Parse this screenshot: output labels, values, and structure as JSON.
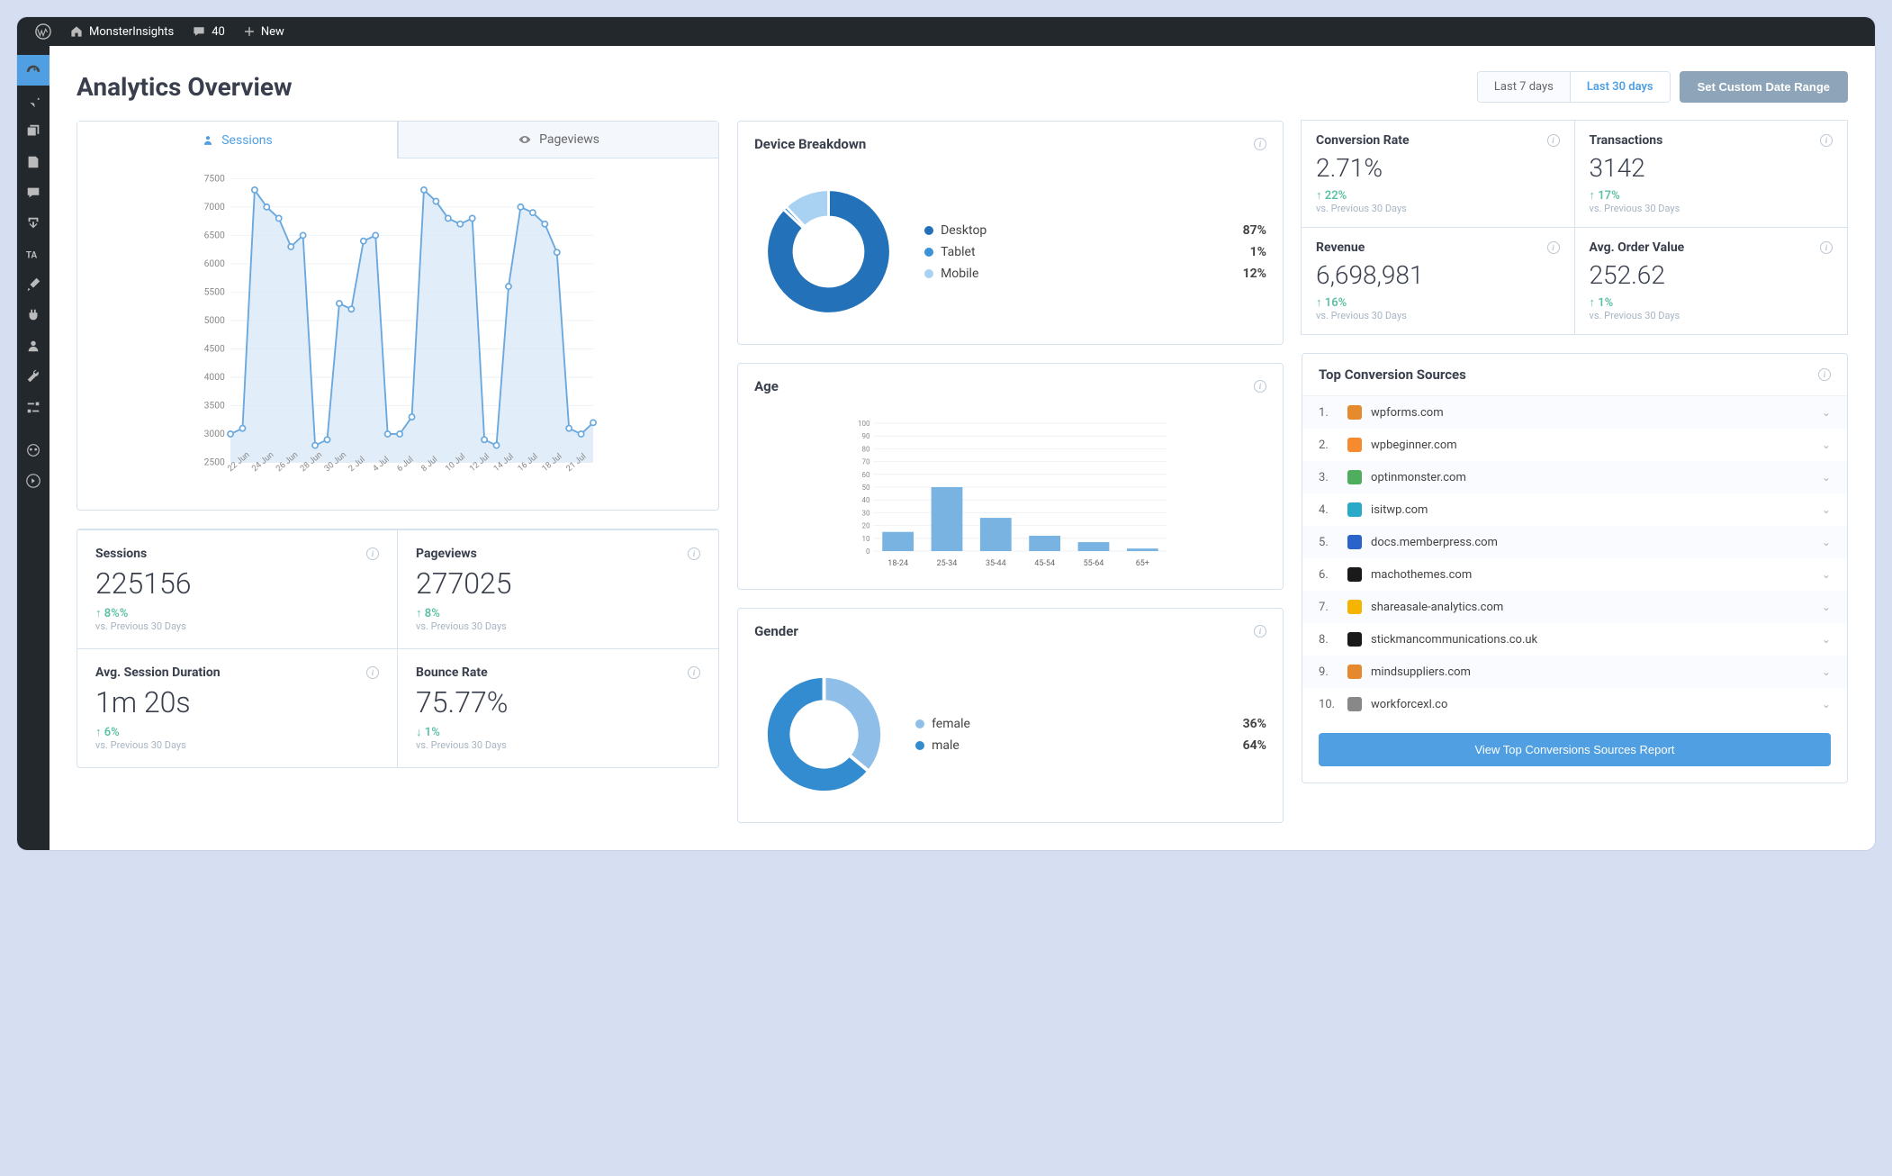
{
  "adminbar": {
    "site": "MonsterInsights",
    "comments": "40",
    "new": "New"
  },
  "page_title": "Analytics Overview",
  "date_range": {
    "tab7": "Last 7 days",
    "tab30": "Last 30 days",
    "custom": "Set Custom Date Range"
  },
  "main_chart": {
    "tab_sessions": "Sessions",
    "tab_pageviews": "Pageviews"
  },
  "stats": [
    {
      "label": "Sessions",
      "value": "225156",
      "delta": "↑ 8%%",
      "dir": "up",
      "vs": "vs. Previous 30 Days"
    },
    {
      "label": "Pageviews",
      "value": "277025",
      "delta": "↑ 8%",
      "dir": "up",
      "vs": "vs. Previous 30 Days"
    },
    {
      "label": "Avg. Session Duration",
      "value": "1m 20s",
      "delta": "↑ 6%",
      "dir": "up",
      "vs": "vs. Previous 30 Days"
    },
    {
      "label": "Bounce Rate",
      "value": "75.77%",
      "delta": "↓ 1%",
      "dir": "down",
      "vs": "vs. Previous 30 Days"
    }
  ],
  "device": {
    "title": "Device Breakdown",
    "legend": [
      {
        "label": "Desktop",
        "value": "87%",
        "color": "#2372b9"
      },
      {
        "label": "Tablet",
        "value": "1%",
        "color": "#3a92d8"
      },
      {
        "label": "Mobile",
        "value": "12%",
        "color": "#a9d2f2"
      }
    ]
  },
  "age": {
    "title": "Age"
  },
  "gender": {
    "title": "Gender",
    "legend": [
      {
        "label": "female",
        "value": "36%",
        "color": "#8fbfe8"
      },
      {
        "label": "male",
        "value": "64%",
        "color": "#338bd0"
      }
    ]
  },
  "ecom": [
    {
      "label": "Conversion Rate",
      "value": "2.71%",
      "delta": "↑ 22%",
      "vs": "vs. Previous 30 Days"
    },
    {
      "label": "Transactions",
      "value": "3142",
      "delta": "↑ 17%",
      "vs": "vs. Previous 30 Days"
    },
    {
      "label": "Revenue",
      "value": "6,698,981",
      "delta": "↑ 16%",
      "vs": "vs. Previous 30 Days"
    },
    {
      "label": "Avg. Order Value",
      "value": "252.62",
      "delta": "↑ 1%",
      "vs": "vs. Previous 30 Days"
    }
  ],
  "sources": {
    "title": "Top Conversion Sources",
    "items": [
      {
        "n": "1.",
        "name": "wpforms.com",
        "color": "#e68a2e"
      },
      {
        "n": "2.",
        "name": "wpbeginner.com",
        "color": "#f58a2e"
      },
      {
        "n": "3.",
        "name": "optinmonster.com",
        "color": "#4fae5e"
      },
      {
        "n": "4.",
        "name": "isitwp.com",
        "color": "#2aa9c9"
      },
      {
        "n": "5.",
        "name": "docs.memberpress.com",
        "color": "#2a63c9"
      },
      {
        "n": "6.",
        "name": "machothemes.com",
        "color": "#1a1a1a"
      },
      {
        "n": "7.",
        "name": "shareasale-analytics.com",
        "color": "#f4b400"
      },
      {
        "n": "8.",
        "name": "stickmancommunications.co.uk",
        "color": "#1a1a1a"
      },
      {
        "n": "9.",
        "name": "mindsuppliers.com",
        "color": "#e6882e"
      },
      {
        "n": "10.",
        "name": "workforcexl.co",
        "color": "#888888"
      }
    ],
    "button": "View Top Conversions Sources Report"
  },
  "chart_data": [
    {
      "type": "line",
      "id": "sessions-line",
      "title": "Sessions",
      "ylabel": "Sessions",
      "ylim": [
        2500,
        7500
      ],
      "yticks": [
        2500,
        3000,
        3500,
        4000,
        4500,
        5000,
        5500,
        6000,
        6500,
        7000,
        7500
      ],
      "categories": [
        "22 Jun",
        "24 Jun",
        "26 Jun",
        "28 Jun",
        "30 Jun",
        "2 Jul",
        "4 Jul",
        "6 Jul",
        "8 Jul",
        "10 Jul",
        "12 Jul",
        "14 Jul",
        "16 Jul",
        "18 Jul",
        "21 Jul"
      ],
      "values": [
        3000,
        3100,
        7300,
        7000,
        6800,
        6300,
        6500,
        2800,
        2900,
        5300,
        5200,
        6400,
        6500,
        3000,
        3000,
        3300,
        7300,
        7100,
        6800,
        6700,
        6800,
        2900,
        2800,
        5600,
        7000,
        6900,
        6700,
        6200,
        3100,
        3000,
        3200
      ]
    },
    {
      "type": "pie",
      "id": "device-donut",
      "title": "Device Breakdown",
      "series": [
        {
          "name": "Desktop",
          "value": 87
        },
        {
          "name": "Tablet",
          "value": 1
        },
        {
          "name": "Mobile",
          "value": 12
        }
      ]
    },
    {
      "type": "bar",
      "id": "age-bar",
      "title": "Age",
      "ylim": [
        0,
        100
      ],
      "yticks": [
        0,
        10,
        20,
        30,
        40,
        50,
        60,
        70,
        80,
        90,
        100
      ],
      "categories": [
        "18-24",
        "25-34",
        "35-44",
        "45-54",
        "55-64",
        "65+"
      ],
      "values": [
        15,
        50,
        26,
        12,
        7,
        2
      ]
    },
    {
      "type": "pie",
      "id": "gender-donut",
      "title": "Gender",
      "series": [
        {
          "name": "female",
          "value": 36
        },
        {
          "name": "male",
          "value": 64
        }
      ]
    }
  ]
}
